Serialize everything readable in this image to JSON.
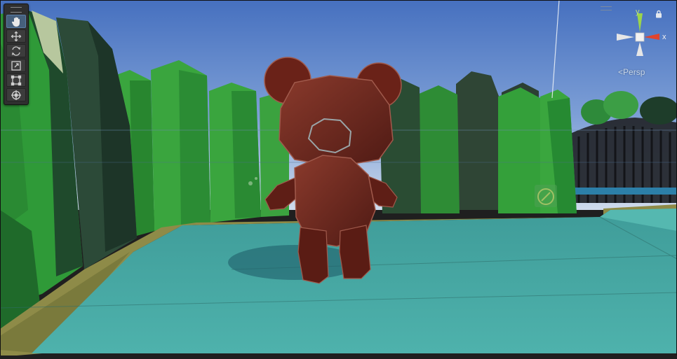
{
  "scene_view": {
    "projection_label": "Persp",
    "gizmo": {
      "y_label": "y",
      "x_label": "x"
    }
  },
  "toolbar": {
    "tools": [
      {
        "name": "hand-tool",
        "icon": "hand-icon",
        "active": true
      },
      {
        "name": "move-tool",
        "icon": "move-arrows-icon",
        "active": false
      },
      {
        "name": "rotate-tool",
        "icon": "rotate-icon",
        "active": false
      },
      {
        "name": "scale-tool",
        "icon": "scale-icon",
        "active": false
      },
      {
        "name": "rect-tool",
        "icon": "rect-transform-icon",
        "active": false
      },
      {
        "name": "transform-tool",
        "icon": "transform-icon",
        "active": false
      }
    ]
  },
  "colors": {
    "sky_top": "#4d77c5",
    "sky_bottom": "#c9d6e8",
    "floor": "#47a5a0",
    "grass_edge": "#8a8a4a",
    "hedge_light": "#3aa03c",
    "hedge_dark": "#1f5a2c",
    "bear": "#6e2a20",
    "bear_highlight": "#9a4a3c",
    "gizmo_x": "#e0442e",
    "gizmo_y": "#9cd54b",
    "gizmo_z": "#3b73d9",
    "active_tool": "#46607c"
  }
}
